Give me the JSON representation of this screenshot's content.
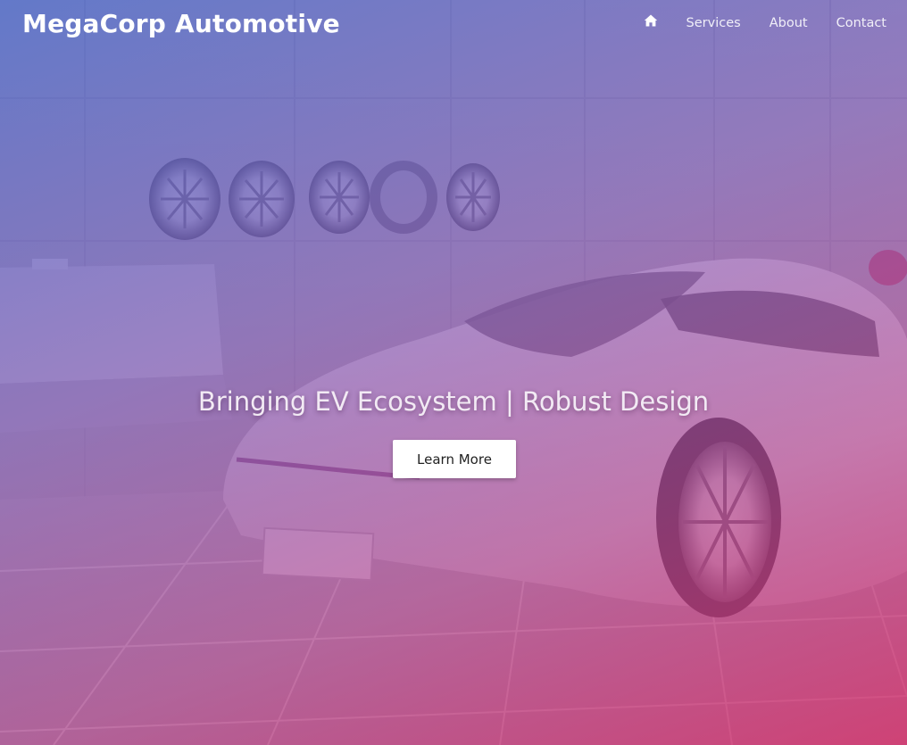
{
  "brand": {
    "name": "MegaCorp Automotive"
  },
  "nav": {
    "home_icon": "home-icon",
    "items": [
      {
        "label": "Services"
      },
      {
        "label": "About"
      },
      {
        "label": "Contact"
      }
    ]
  },
  "hero": {
    "headline": "Bringing EV Ecosystem | Robust Design",
    "cta_label": "Learn More",
    "background_image": "electric sports car in showroom with wheel rims on wall"
  },
  "colors": {
    "gradient_start": "#4664c8",
    "gradient_mid": "#8a58b4",
    "gradient_end": "#d72d69",
    "cta_background": "#ffffff",
    "text": "#ffffff"
  }
}
